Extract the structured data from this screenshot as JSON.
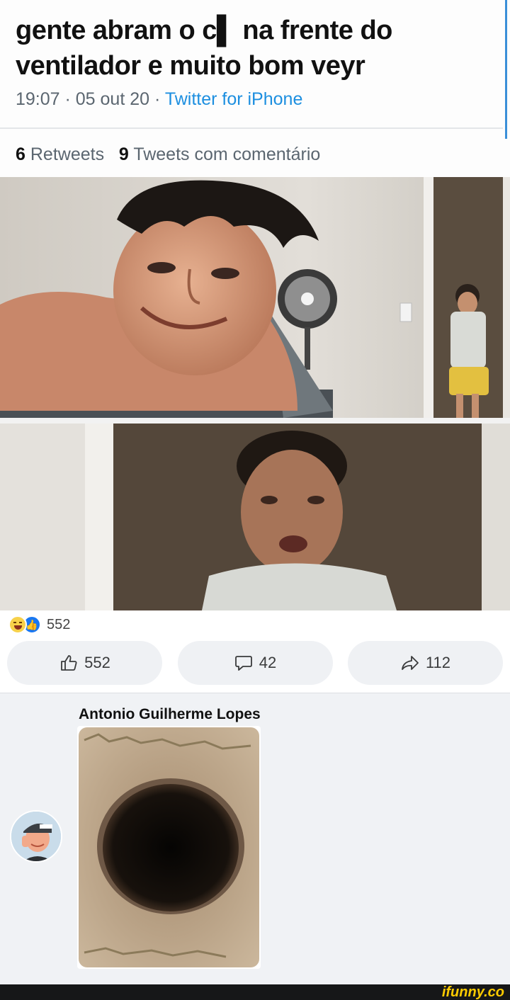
{
  "tweet": {
    "text": "gente abram o c▌ na frente do ventilador e muito bom veyr",
    "time": "19:07 · 05 out 20 · ",
    "source": "Twitter for iPhone",
    "retweets_count": "6",
    "retweets_label": "Retweets",
    "quotes_count": "9",
    "quotes_label": "Tweets com comentário"
  },
  "post": {
    "reaction_count": "552",
    "like_count": "552",
    "comment_count": "42",
    "share_count": "112"
  },
  "comment": {
    "author": "Antonio Guilherme Lopes"
  },
  "footer": {
    "watermark": "ifunny.co"
  },
  "colors": {
    "accent": "#1877f2",
    "twitter_blue": "#1d8fe0",
    "background": "#f0f2f5"
  },
  "icons": [
    "like-icon",
    "comment-icon",
    "share-icon",
    "haha-reaction-icon",
    "like-reaction-icon"
  ]
}
